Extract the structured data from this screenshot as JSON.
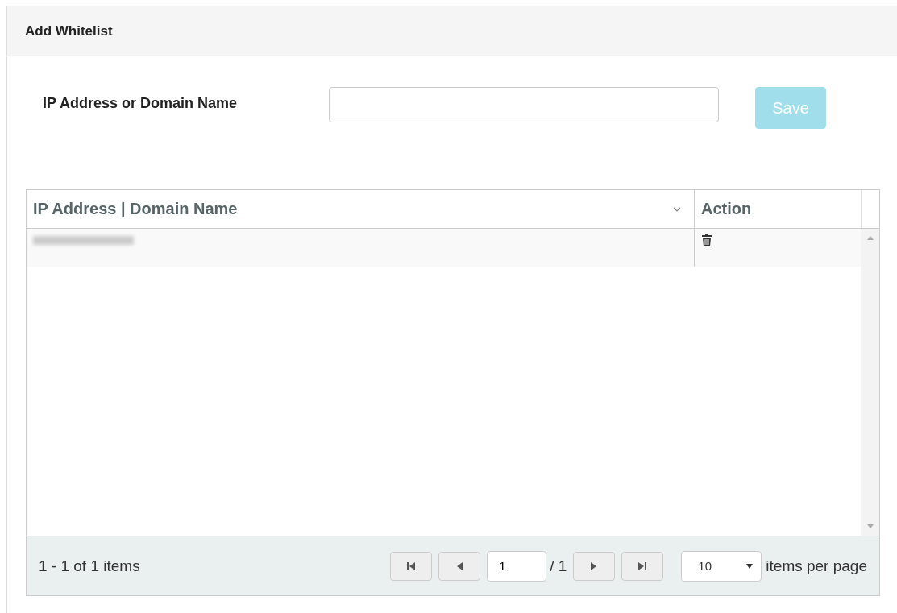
{
  "panel": {
    "title": "Add Whitelist"
  },
  "form": {
    "label": "IP Address or Domain Name",
    "button": {
      "label": "Save",
      "disabled": true
    }
  },
  "grid": {
    "columns": [
      {
        "label": "IP Address | Domain Name",
        "sortable": true
      },
      {
        "label": "Action",
        "sortable": false
      }
    ],
    "rows": [
      {
        "kind": "redacted"
      }
    ],
    "pager": {
      "summary": "1 - 1 of 1 items",
      "page": "1",
      "of": "/ 1",
      "page_size": "10",
      "page_size_label": "items per page"
    }
  }
}
